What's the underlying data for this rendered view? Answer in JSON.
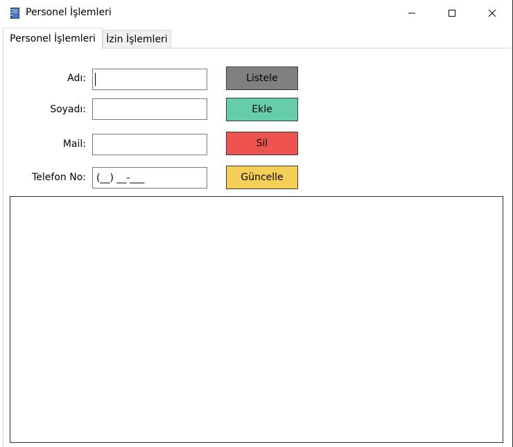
{
  "window": {
    "title": "Personel İşlemleri",
    "app_icon": "notebook-icon",
    "controls": [
      "minimize-icon",
      "maximize-icon",
      "close-icon"
    ]
  },
  "tabs": [
    {
      "label": "Personel İşlemleri",
      "active": true
    },
    {
      "label": "İzin İşlemleri",
      "active": false
    }
  ],
  "form": {
    "name_label": "Adı:",
    "name_value": "",
    "surname_label": "Soyadı:",
    "surname_value": "",
    "mail_label": "Mail:",
    "mail_value": "",
    "phone_label": "Telefon No:",
    "phone_value": "(__) __-___"
  },
  "buttons": {
    "list": "Listele",
    "add": "Ekle",
    "delete": "Sil",
    "update": "Güncelle"
  },
  "colors": {
    "list": "#808080",
    "add": "#66cdaa",
    "delete": "#ef5350",
    "update": "#f5ce55"
  },
  "grid": {
    "rows": []
  }
}
